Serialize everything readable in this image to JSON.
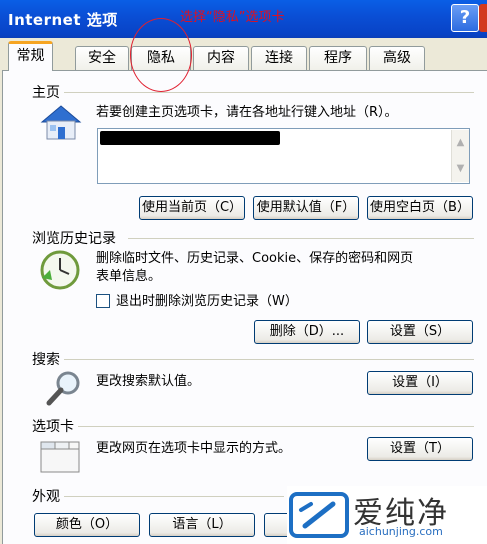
{
  "window": {
    "title": "Internet 选项",
    "help_button": "?",
    "annotation": "选择“隐私”选项卡"
  },
  "tabs": [
    {
      "label": "常规",
      "active": true
    },
    {
      "label": "安全",
      "active": false
    },
    {
      "label": "隐私",
      "active": false
    },
    {
      "label": "内容",
      "active": false
    },
    {
      "label": "连接",
      "active": false
    },
    {
      "label": "程序",
      "active": false
    },
    {
      "label": "高级",
      "active": false
    }
  ],
  "homepage": {
    "label": "主页",
    "description": "若要创建主页选项卡，请在各地址行键入地址（R）。",
    "buttons": {
      "use_current": "使用当前页（C）",
      "use_default": "使用默认值（F）",
      "use_blank": "使用空白页（B）"
    }
  },
  "history": {
    "label": "浏览历史记录",
    "description_line1": "删除临时文件、历史记录、Cookie、保存的密码和网页",
    "description_line2": "表单信息。",
    "checkbox_label": "退出时删除浏览历史记录（W）",
    "checkbox_checked": false,
    "buttons": {
      "delete": "删除（D）...",
      "settings": "设置（S）"
    }
  },
  "search": {
    "label": "搜索",
    "description": "更改搜索默认值。",
    "settings_button": "设置（I）"
  },
  "tabs_section": {
    "label": "选项卡",
    "description": "更改网页在选项卡中显示的方式。",
    "settings_button": "设置（T）"
  },
  "appearance": {
    "label": "外观",
    "buttons": {
      "colors": "颜色（O）",
      "languages": "语言（L）"
    }
  },
  "watermark": {
    "main": "爱纯净",
    "sub": "aichunjing.com"
  },
  "colors": {
    "titlebar": "#0a4fd6",
    "active_tab_accent": "#f6a522",
    "annotation": "#e01020",
    "button_border": "#003c74"
  }
}
